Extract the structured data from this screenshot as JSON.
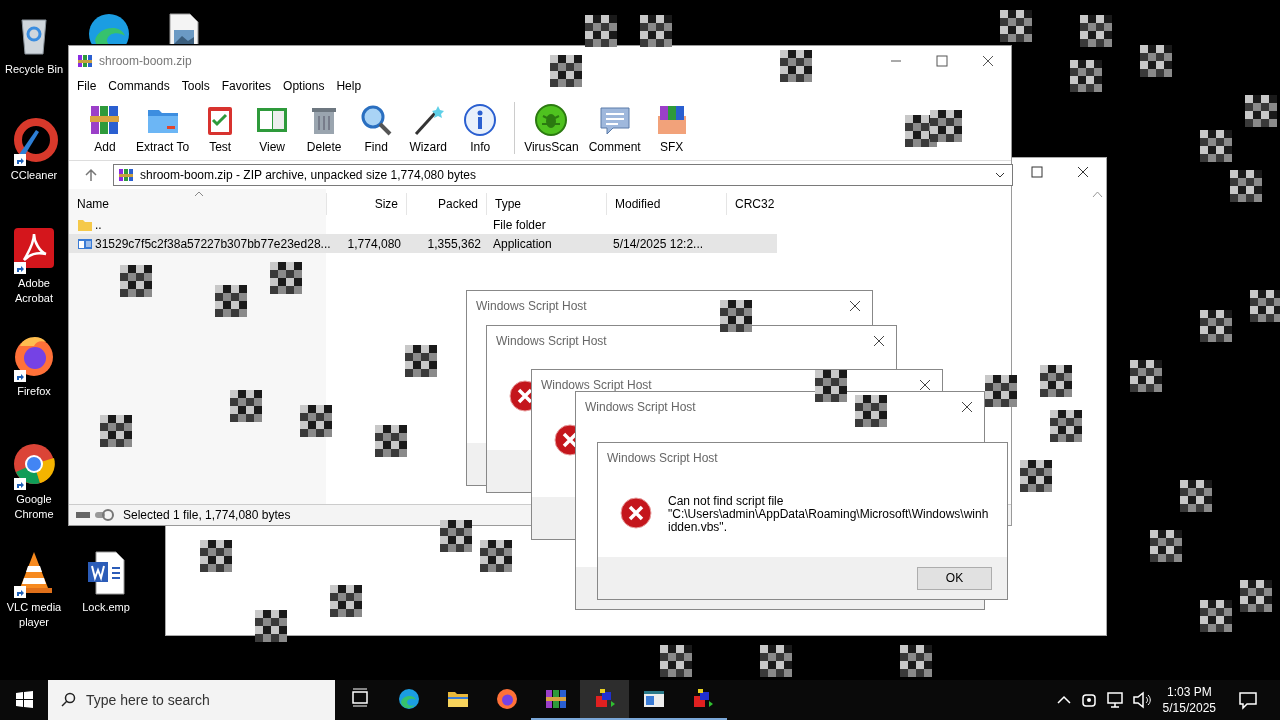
{
  "desktop_icons": [
    {
      "kind": "recycle",
      "label": "Recycle Bin"
    },
    {
      "kind": "edge"
    },
    {
      "kind": "image"
    },
    {
      "kind": "ccleaner",
      "label": "CCleaner",
      "shortcut": true
    },
    {
      "kind": "acrobat",
      "label": "Adobe Acrobat",
      "shortcut": true
    },
    {
      "kind": "firefox",
      "label": "Firefox",
      "shortcut": true
    },
    {
      "kind": "chrome",
      "label": "Google Chrome",
      "shortcut": true
    },
    {
      "kind": "vlc",
      "label": "VLC media player",
      "shortcut": true
    },
    {
      "kind": "word",
      "label": "Lock.emp"
    }
  ],
  "winrar": {
    "title": "shroom-boom.zip",
    "menu": [
      "File",
      "Commands",
      "Tools",
      "Favorites",
      "Options",
      "Help"
    ],
    "toolbar": [
      {
        "kind": "add",
        "label": "Add"
      },
      {
        "kind": "extract",
        "label": "Extract To"
      },
      {
        "kind": "test",
        "label": "Test"
      },
      {
        "kind": "view",
        "label": "View"
      },
      {
        "kind": "delete",
        "label": "Delete"
      },
      {
        "kind": "find",
        "label": "Find"
      },
      {
        "kind": "wizard",
        "label": "Wizard"
      },
      {
        "kind": "info",
        "label": "Info"
      },
      {
        "kind": "separator"
      },
      {
        "kind": "virusscan",
        "label": "VirusScan"
      },
      {
        "kind": "comment",
        "label": "Comment"
      },
      {
        "kind": "sfx",
        "label": "SFX"
      }
    ],
    "address": "shroom-boom.zip - ZIP archive, unpacked size 1,774,080 bytes",
    "columns": [
      "Name",
      "Size",
      "Packed",
      "Type",
      "Modified",
      "CRC32"
    ],
    "rows": [
      {
        "kind": "folder",
        "name": "..",
        "size": "",
        "packed": "",
        "type": "File folder",
        "modified": "",
        "selected": false
      },
      {
        "kind": "application",
        "name": "31529c7f5c2f38a57227b307bb77e23ed28...",
        "size": "1,774,080",
        "packed": "1,355,362",
        "type": "Application",
        "modified": "5/14/2025 12:2...",
        "selected": true
      }
    ],
    "status": "Selected 1 file, 1,774,080 bytes"
  },
  "dialogs": [
    {
      "kind": "plain",
      "title": "Windows Script Host",
      "closable": true
    },
    {
      "kind": "error",
      "title": "Windows Script Host",
      "closable": true
    },
    {
      "kind": "error",
      "title": "Windows Script Host",
      "closable": true
    },
    {
      "kind": "plain",
      "title": "Windows Script Host",
      "closable": true
    },
    {
      "kind": "error",
      "title": "Windows Script Host",
      "closable": false,
      "message": "Can not find script file\n\"C:\\Users\\admin\\AppData\\Roaming\\Microsoft\\Windows\\winhidden.vbs\".",
      "button": "OK"
    }
  ],
  "taskbar": {
    "search_placeholder": "Type here to search",
    "apps": [
      {
        "kind": "taskview",
        "running": false,
        "selected": false
      },
      {
        "kind": "edge",
        "running": false,
        "selected": false
      },
      {
        "kind": "explorer",
        "running": false,
        "selected": false
      },
      {
        "kind": "firefox",
        "running": false,
        "selected": false
      },
      {
        "kind": "winrar",
        "running": true,
        "selected": false
      },
      {
        "kind": "cube",
        "running": true,
        "selected": true
      },
      {
        "kind": "window",
        "running": true,
        "selected": false
      },
      {
        "kind": "cube",
        "running": true,
        "selected": false
      }
    ],
    "time": "1:03 PM",
    "date": "5/15/2025"
  }
}
